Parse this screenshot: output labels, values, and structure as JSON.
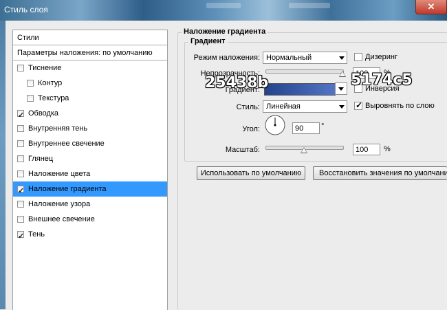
{
  "window": {
    "title": "Стиль слоя",
    "close_glyph": "✕"
  },
  "styles_panel": {
    "header": "Стили",
    "blend_defaults": "Параметры наложения: по умолчанию",
    "items": [
      {
        "label": "Тиснение",
        "checked": false
      },
      {
        "label": "Контур",
        "checked": false
      },
      {
        "label": "Текстура",
        "checked": false
      },
      {
        "label": "Обводка",
        "checked": true
      },
      {
        "label": "Внутренняя тень",
        "checked": false
      },
      {
        "label": "Внутреннее свечение",
        "checked": false
      },
      {
        "label": "Глянец",
        "checked": false
      },
      {
        "label": "Наложение цвета",
        "checked": false
      },
      {
        "label": "Наложение градиента",
        "checked": true,
        "selected": true
      },
      {
        "label": "Наложение узора",
        "checked": false
      },
      {
        "label": "Внешнее свечение",
        "checked": false
      },
      {
        "label": "Тень",
        "checked": true
      }
    ]
  },
  "gradient_overlay": {
    "section_title": "Наложение градиента",
    "group_title": "Градиент",
    "blend_mode_label": "Режим наложения:",
    "blend_mode_value": "Нормальный",
    "dither_label": "Дизеринг",
    "dither_checked": false,
    "opacity_label": "Непрозрачность:",
    "opacity_value": "100",
    "opacity_unit": "%",
    "opacity_level": 1.0,
    "gradient_label": "Градиент:",
    "gradient_colors": [
      "#25438b",
      "#5174c5"
    ],
    "reverse_label": "Инверсия",
    "reverse_checked": false,
    "style_label": "Стиль:",
    "style_value": "Линейная",
    "align_label": "Выровнять по слою",
    "align_checked": true,
    "angle_label": "Угол:",
    "angle_value": "90",
    "angle_unit": "°",
    "scale_label": "Масштаб:",
    "scale_value": "100",
    "scale_unit": "%",
    "scale_level": 0.5,
    "default_button": "Использовать по умолчанию",
    "reset_button": "Восстановить значения по умолчанию"
  },
  "color_annotations": {
    "left": "25438b",
    "right": "5174c5"
  }
}
